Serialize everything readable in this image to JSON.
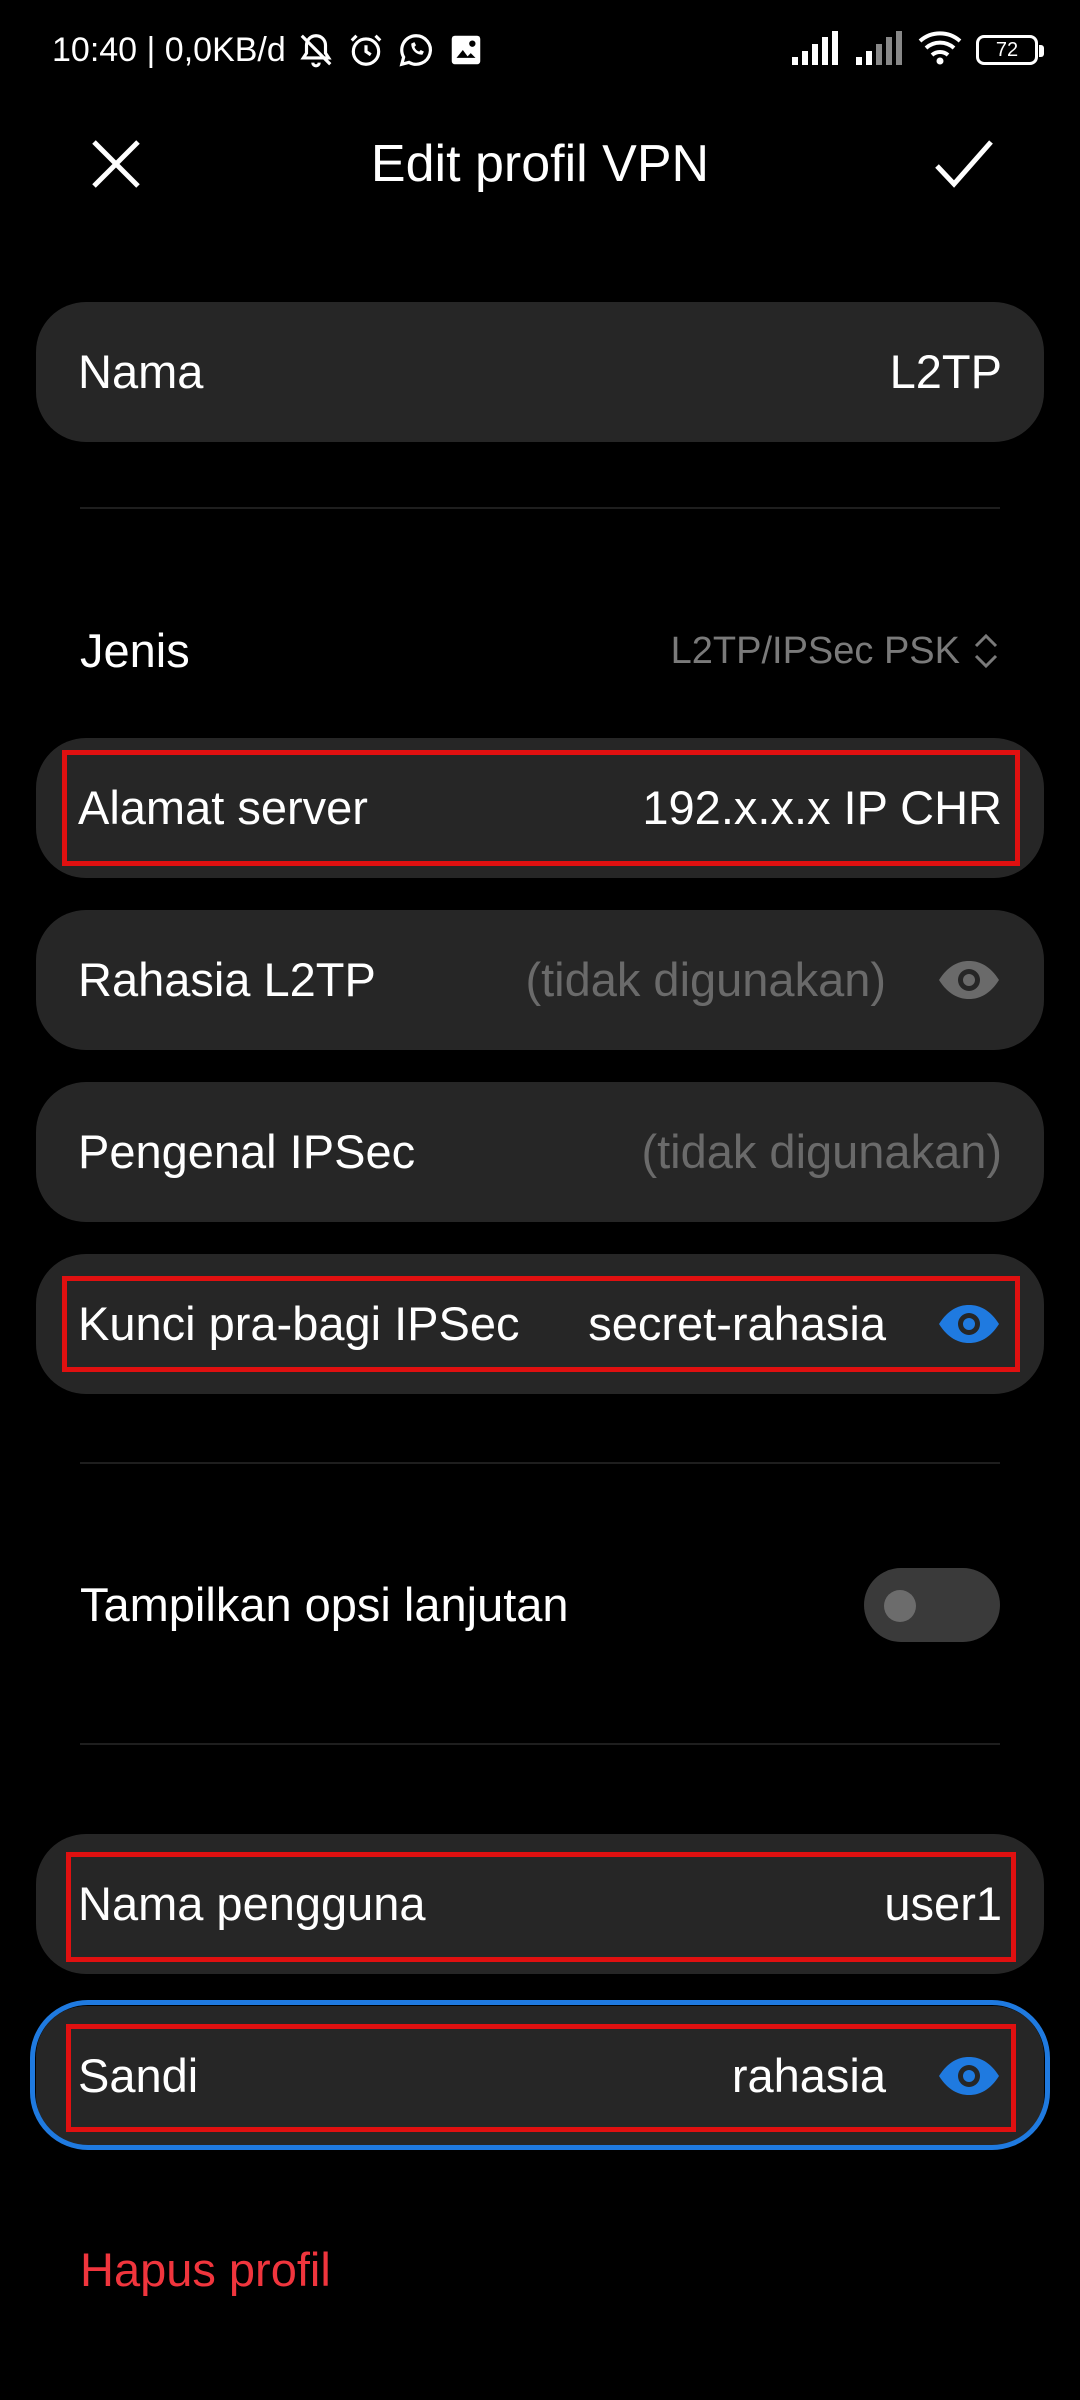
{
  "status_bar": {
    "time_info": "10:40 | 0,0KB/d",
    "battery": "72",
    "icons": [
      "mute-bell-icon",
      "alarm-icon",
      "whatsapp-icon",
      "image-icon",
      "signal-icon",
      "signal-icon",
      "wifi-icon",
      "battery-icon"
    ]
  },
  "header": {
    "title": "Edit profil VPN",
    "close_icon": "close-icon",
    "save_icon": "check-icon"
  },
  "form": {
    "name": {
      "label": "Nama",
      "value": "L2TP"
    },
    "type": {
      "label": "Jenis",
      "value": "L2TP/IPSec PSK"
    },
    "server": {
      "label": "Alamat server",
      "value": "192.x.x.x IP CHR"
    },
    "l2tp_secret": {
      "label": "Rahasia L2TP",
      "placeholder": "(tidak digunakan)"
    },
    "ipsec_id": {
      "label": "Pengenal IPSec",
      "placeholder": "(tidak digunakan)"
    },
    "ipsec_psk": {
      "label": "Kunci pra-bagi IPSec",
      "value": "secret-rahasia"
    },
    "advanced": {
      "label": "Tampilkan opsi lanjutan",
      "enabled": false
    },
    "username": {
      "label": "Nama pengguna",
      "value": "user1"
    },
    "password": {
      "label": "Sandi",
      "value": "rahasia"
    }
  },
  "delete_label": "Hapus profil",
  "colors": {
    "background": "#000000",
    "card": "#262626",
    "accent_blue": "#1f7ae0",
    "highlight_red": "#e01010",
    "delete_red": "#f0353d"
  }
}
